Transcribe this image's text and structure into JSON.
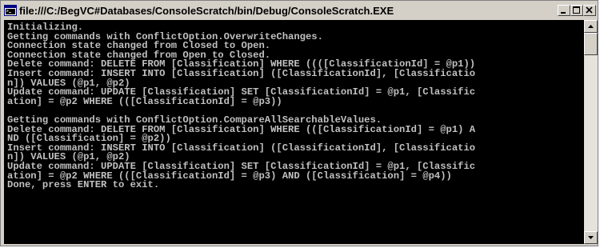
{
  "window": {
    "title": "file:///C:/BegVC#Databases/ConsoleScratch/bin/Debug/ConsoleScratch.EXE",
    "controls": {
      "minimize": "minimize-icon",
      "maximize": "maximize-icon",
      "close": "close-icon"
    }
  },
  "console": {
    "lines": [
      "Initializing.",
      "Getting commands with ConflictOption.OverwriteChanges.",
      "Connection state changed from Closed to Open.",
      "Connection state changed from Open to Closed.",
      "Delete command: DELETE FROM [Classification] WHERE ((([ClassificationId] = @p1))",
      "Insert command: INSERT INTO [Classification] ([ClassificationId], [Classificatio",
      "n]) VALUES (@p1, @p2)",
      "Update command: UPDATE [Classification] SET [ClassificationId] = @p1, [Classific",
      "ation] = @p2 WHERE (([ClassificationId] = @p3))",
      "",
      "Getting commands with ConflictOption.CompareAllSearchableValues.",
      "Delete command: DELETE FROM [Classification] WHERE (([ClassificationId] = @p1) A",
      "ND ([Classification] = @p2))",
      "Insert command: INSERT INTO [Classification] ([ClassificationId], [Classificatio",
      "n]) VALUES (@p1, @p2)",
      "Update command: UPDATE [Classification] SET [ClassificationId] = @p1, [Classific",
      "ation] = @p2 WHERE (([ClassificationId] = @p3) AND ([Classification] = @p4))",
      "Done, press ENTER to exit."
    ]
  },
  "colors": {
    "console_bg": "#000000",
    "console_fg": "#c0c0c0",
    "chrome": "#d4d0c8"
  }
}
